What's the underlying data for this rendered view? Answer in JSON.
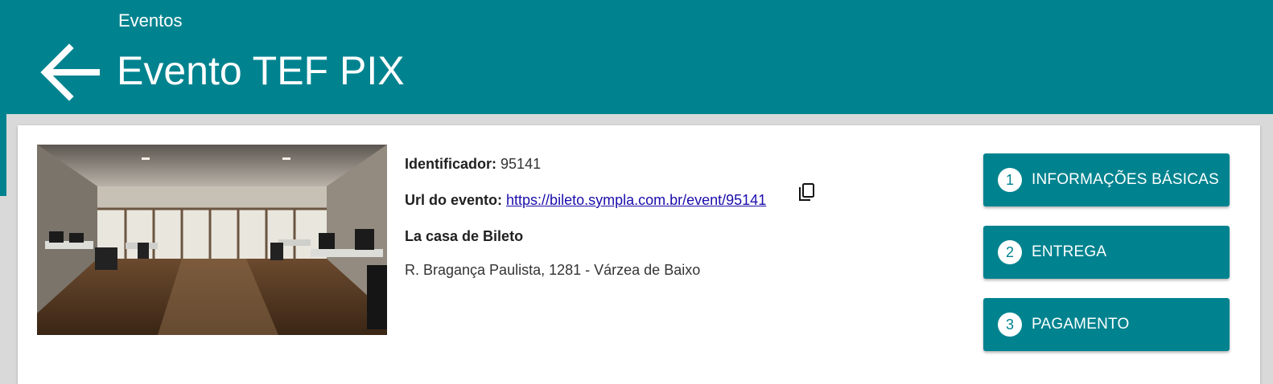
{
  "header": {
    "breadcrumb": "Eventos",
    "title": "Evento TEF PIX",
    "back_icon": "arrow-left-icon"
  },
  "event": {
    "image_alt": "office-interior-photo",
    "identifier_label": "Identificador:",
    "identifier_value": "95141",
    "url_label": "Url do evento:",
    "url_value": "https://bileto.sympla.com.br/event/95141",
    "copy_icon": "copy-icon",
    "venue": "La casa de Bileto",
    "address": "R. Bragança Paulista, 1281 - Várzea de Baixo"
  },
  "steps": [
    {
      "number": "1",
      "label": "INFORMAÇÕES BÁSICAS"
    },
    {
      "number": "2",
      "label": "ENTREGA"
    },
    {
      "number": "3",
      "label": "PAGAMENTO"
    }
  ],
  "colors": {
    "primary": "#00838f",
    "link": "#1a0dab"
  }
}
